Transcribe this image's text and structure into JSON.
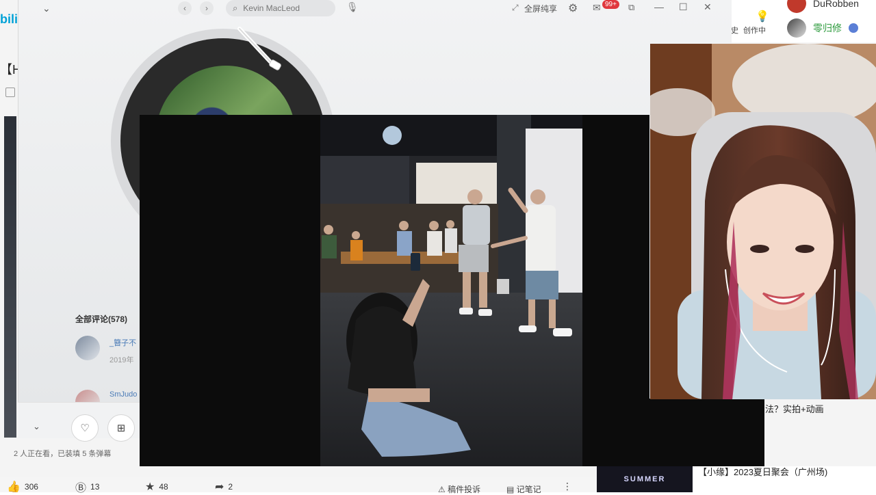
{
  "bilibili": {
    "logo": "bili",
    "left_title_fragment": "【H",
    "status_text": "2 人正在看，已装填 5 条弹幕",
    "stats": [
      {
        "icon": "thumb-up-icon",
        "value": "306"
      },
      {
        "icon": "coin-icon",
        "value": "13"
      },
      {
        "icon": "star-icon",
        "value": "48"
      },
      {
        "icon": "share-icon",
        "value": "2"
      }
    ],
    "report_label": "稿件投诉",
    "notes_label": "记笔记",
    "creator_label_left": "史",
    "creator_label": "创作中",
    "users": [
      {
        "name": "DuRobben"
      },
      {
        "name": "零归修"
      }
    ],
    "rec_1_fragment": "法？实拍+动画",
    "rec_2_title": "【小缘】2023夏日聚会（广州场)",
    "rec_2_thumb_text": "SUMMER"
  },
  "player": {
    "search_placeholder": "Kevin MacLeod",
    "fullscreen_label": "全屏纯享",
    "mail_badge": "99+",
    "comments_header": "全部评论(578)",
    "comments": [
      {
        "name": "_簪子不",
        "date": "2019年"
      },
      {
        "name": "SmJudo"
      }
    ]
  },
  "colors": {
    "accent_blue": "#00a1d6",
    "badge_red": "#e0383e",
    "user_name_green": "#2e9b3e"
  }
}
